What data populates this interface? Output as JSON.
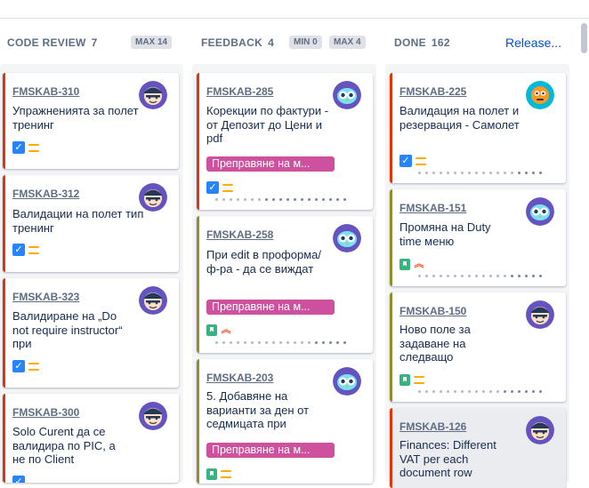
{
  "columns": [
    {
      "name": "CODE REVIEW",
      "count": "7",
      "max_label": "MAX 14"
    },
    {
      "name": "FEEDBACK",
      "count": "4",
      "min_label": "MIN 0",
      "max_label": "MAX 4"
    },
    {
      "name": "DONE",
      "count": "162",
      "release_label": "Release..."
    }
  ],
  "colors": {
    "bug": "#de350b",
    "story": "#8f8f2a",
    "epic": "#cd519d",
    "link": "#0052cc"
  },
  "cards": {
    "c310": {
      "key": "FMSKAB-310",
      "title": "Упражненията за полет тренинг",
      "avatar": "pirate-avatar"
    },
    "c312": {
      "key": "FMSKAB-312",
      "title": "Валидации на полет тип тренинг",
      "avatar": "pirate-avatar"
    },
    "c323": {
      "key": "FMSKAB-323",
      "title": "Валидиране на „Do not require instructor“ при",
      "avatar": "pirate-avatar"
    },
    "c300": {
      "key": "FMSKAB-300",
      "title": "Solo Curent да се валидира по PIC, а не по Client",
      "avatar": "pirate-avatar"
    },
    "c285": {
      "key": "FMSKAB-285",
      "title": "Корекции по фактури - от Депозит до Цени и pdf",
      "epic": "Преправяне на м...",
      "avatar": "owl-avatar"
    },
    "c258": {
      "key": "FMSKAB-258",
      "title": "При edit в проформа/ф-ра - да се виждат",
      "epic": "Преправяне на м...",
      "avatar": "owl-avatar"
    },
    "c203": {
      "key": "FMSKAB-203",
      "title": "5. Добавяне на варианти за ден от седмицата при",
      "epic": "Преправяне на м...",
      "avatar": "owl-avatar"
    },
    "c225": {
      "key": "FMSKAB-225",
      "title": "Валидация на полет и резервация - Самолет",
      "avatar": "robot-avatar"
    },
    "c151": {
      "key": "FMSKAB-151",
      "title": "Промяна на Duty time меню",
      "avatar": "owl-avatar"
    },
    "c150": {
      "key": "FMSKAB-150",
      "title": "Ново поле за задаване на следващо",
      "avatar": "pirate-avatar"
    },
    "c126": {
      "key": "FMSKAB-126",
      "title": "Finances: Different VAT per each document row",
      "avatar": "pirate-avatar"
    }
  }
}
